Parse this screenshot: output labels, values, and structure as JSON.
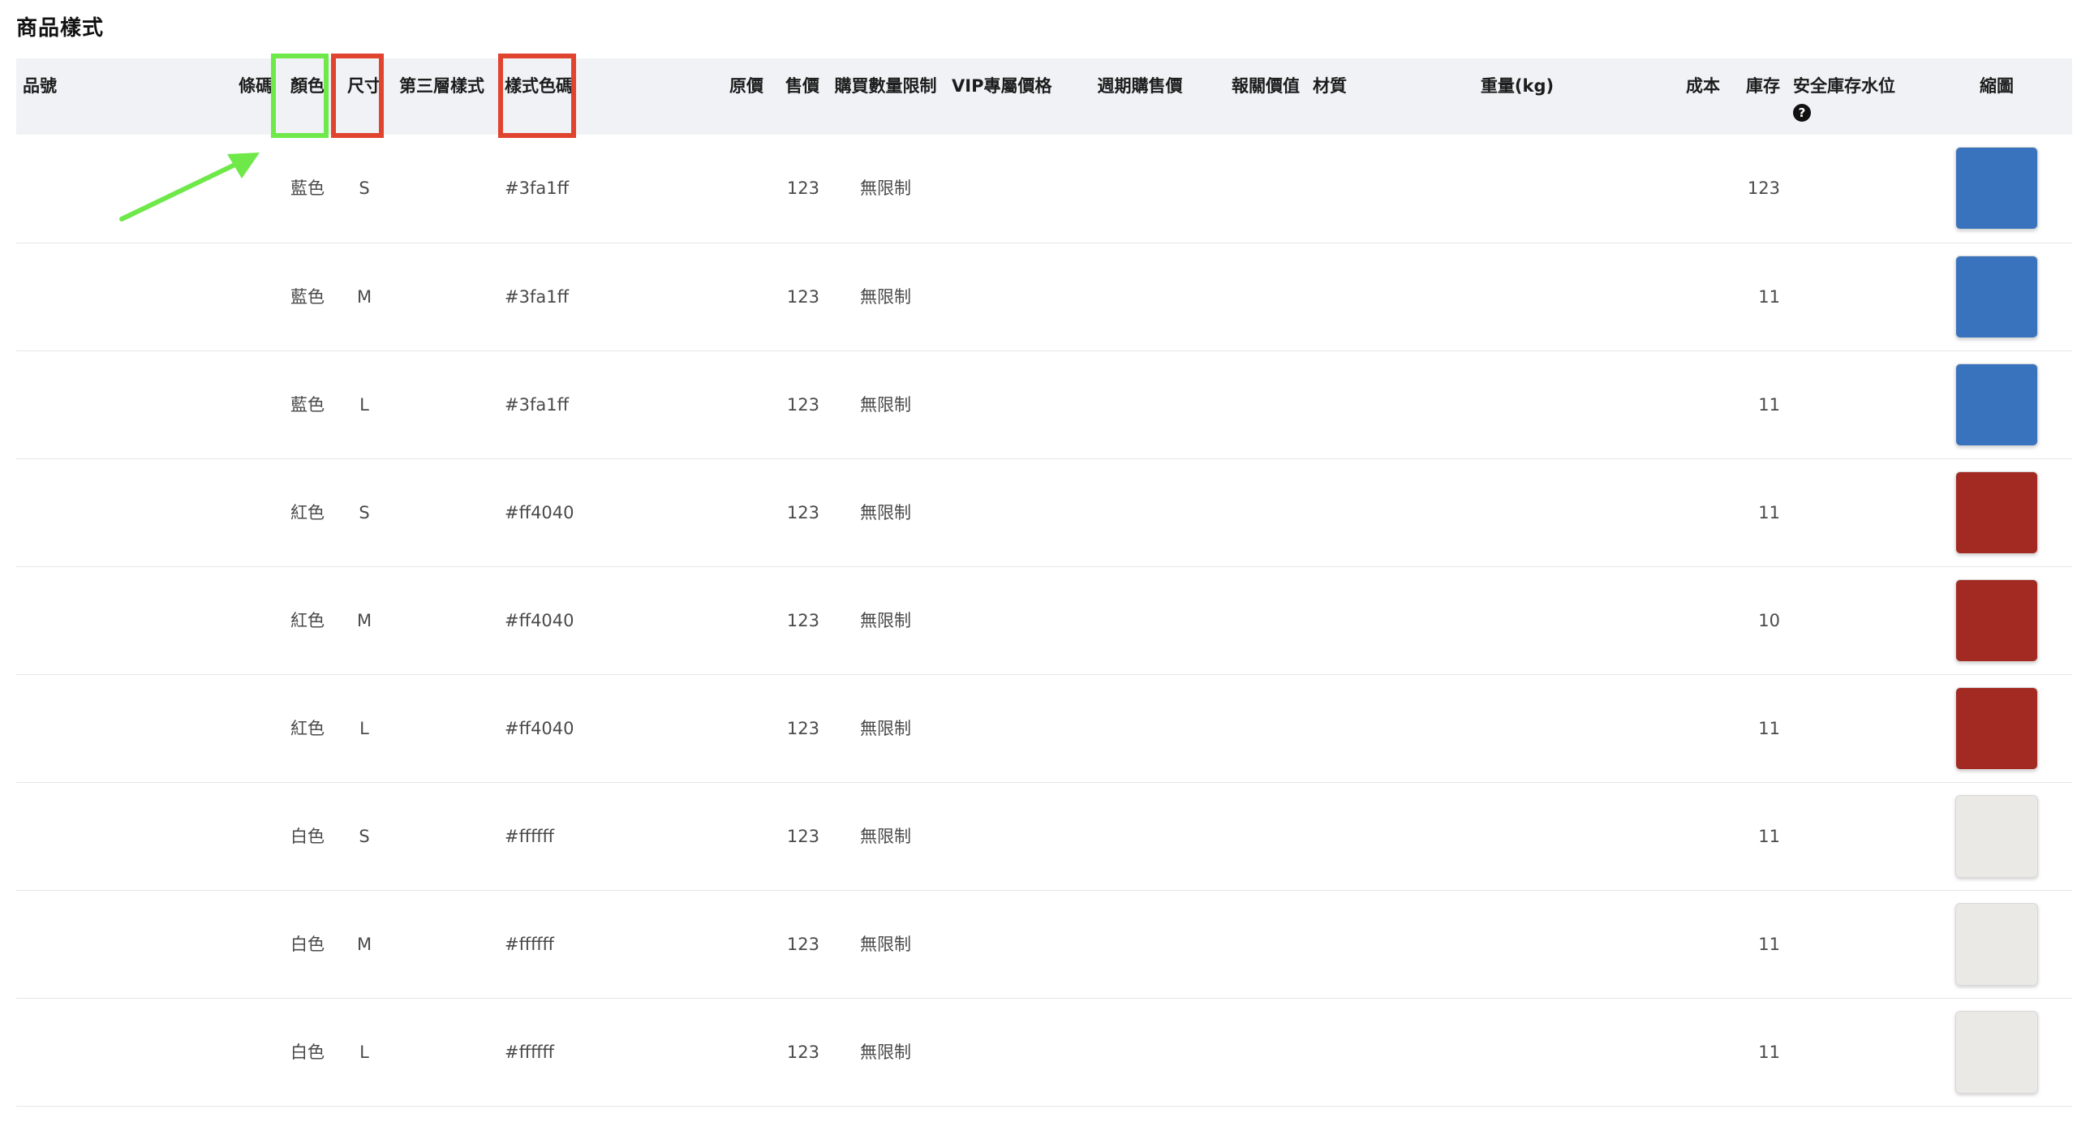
{
  "page": {
    "title": "商品樣式"
  },
  "table": {
    "headers": {
      "sku": "品號",
      "barcode": "條碼",
      "color": "顏色",
      "size": "尺寸",
      "third_style": "第三層樣式",
      "style_color_code": "樣式色碼",
      "original_price": "原價",
      "sale_price": "售價",
      "purchase_limit": "購買數量限制",
      "vip_price": "VIP專屬價格",
      "periodic_price": "週期購售價",
      "customs_value": "報關價值",
      "material": "材質",
      "weight": "重量(kg)",
      "cost": "成本",
      "stock": "庫存",
      "safety_stock": "安全庫存水位",
      "thumbnail": "縮圖",
      "safety_stock_help_icon": "question-circle-icon"
    },
    "rows": [
      {
        "color": "藍色",
        "size": "S",
        "code": "#3fa1ff",
        "price": "123",
        "limit": "無限制",
        "stock": "123",
        "swatch": "#3a73bd"
      },
      {
        "color": "藍色",
        "size": "M",
        "code": "#3fa1ff",
        "price": "123",
        "limit": "無限制",
        "stock": "11",
        "swatch": "#3a73bd"
      },
      {
        "color": "藍色",
        "size": "L",
        "code": "#3fa1ff",
        "price": "123",
        "limit": "無限制",
        "stock": "11",
        "swatch": "#3a73bd"
      },
      {
        "color": "紅色",
        "size": "S",
        "code": "#ff4040",
        "price": "123",
        "limit": "無限制",
        "stock": "11",
        "swatch": "#a32a22"
      },
      {
        "color": "紅色",
        "size": "M",
        "code": "#ff4040",
        "price": "123",
        "limit": "無限制",
        "stock": "10",
        "swatch": "#a32a22"
      },
      {
        "color": "紅色",
        "size": "L",
        "code": "#ff4040",
        "price": "123",
        "limit": "無限制",
        "stock": "11",
        "swatch": "#a32a22"
      },
      {
        "color": "白色",
        "size": "S",
        "code": "#ffffff",
        "price": "123",
        "limit": "無限制",
        "stock": "11",
        "swatch": "#ebe9e6"
      },
      {
        "color": "白色",
        "size": "M",
        "code": "#ffffff",
        "price": "123",
        "limit": "無限制",
        "stock": "11",
        "swatch": "#ebe9e6"
      },
      {
        "color": "白色",
        "size": "L",
        "code": "#ffffff",
        "price": "123",
        "limit": "無限制",
        "stock": "11",
        "swatch": "#ebe9e6"
      }
    ]
  },
  "annotations": {
    "green_color": "#6fe84a",
    "red_color": "#e0432e"
  }
}
